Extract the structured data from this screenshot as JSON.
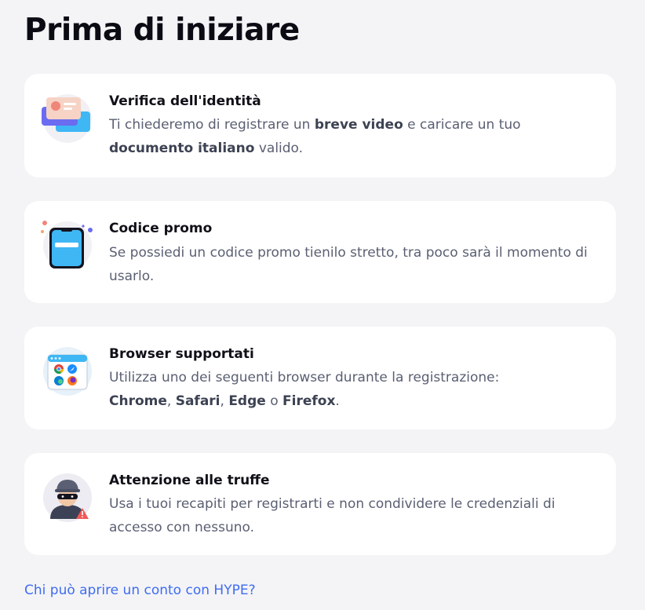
{
  "page": {
    "title": "Prima di iniziare",
    "footer_link": "Chi può aprire un conto con HYPE?"
  },
  "cards": [
    {
      "icon": "id-card-icon",
      "title": "Verifica dell'identità",
      "text_1": "Ti chiederemo di registrare un ",
      "bold_1": "breve video",
      "text_2": " e caricare un tuo ",
      "bold_2": "documento italiano",
      "text_3": " valido."
    },
    {
      "icon": "phone-promo-icon",
      "title": "Codice promo",
      "text": "Se possiedi un codice promo tienilo stretto, tra poco sarà il momento di usarlo."
    },
    {
      "icon": "browser-window-icon",
      "title": "Browser supportati",
      "text_1": "Utilizza uno dei seguenti browser durante la registrazione:",
      "browser_chrome": "Chrome",
      "sep_1": ", ",
      "browser_safari": "Safari",
      "sep_2": ", ",
      "browser_edge": "Edge",
      "sep_3": " o ",
      "browser_firefox": "Firefox",
      "end": "."
    },
    {
      "icon": "scammer-warning-icon",
      "title": "Attenzione alle truffe",
      "text": "Usa i tuoi recapiti per registrarti e non condividere le credenziali di accesso con nessuno."
    }
  ]
}
